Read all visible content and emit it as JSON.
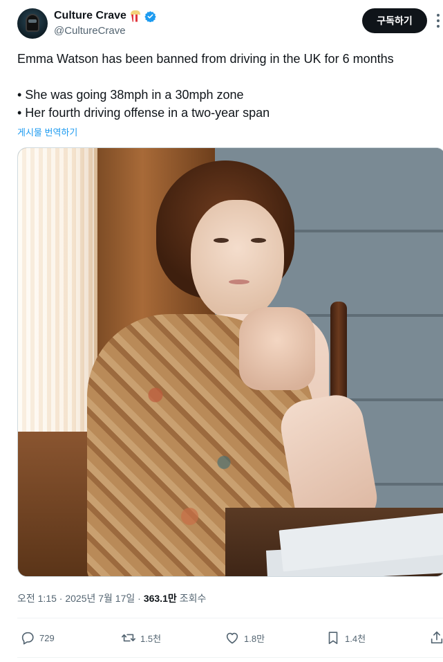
{
  "author": {
    "display_name": "Culture Crave",
    "handle": "@CultureCrave",
    "avatar_icon": "helmet-avatar",
    "badge_icons": [
      "popcorn-icon",
      "verified-icon"
    ],
    "verified_color": "#1d9bf0"
  },
  "header": {
    "subscribe_label": "구독하기"
  },
  "tweet": {
    "lines": [
      "Emma Watson has been banned from driving in the UK for 6 months",
      "",
      "• She was going 38mph in a 30mph zone",
      "• Her fourth driving offense in a two-year span"
    ],
    "translate_label": "게시물 번역하기"
  },
  "meta": {
    "timestamp": "오전 1:15 · 2025년 7월 17일 ·",
    "views_count": "363.1만",
    "views_label": "조회수"
  },
  "actions": {
    "replies": "729",
    "retweets": "1.5천",
    "likes": "1.8만",
    "bookmarks": "1.4천"
  },
  "colors": {
    "text_primary": "#0f1419",
    "text_secondary": "#536471",
    "accent": "#1d9bf0",
    "button_bg": "#0f1419"
  }
}
